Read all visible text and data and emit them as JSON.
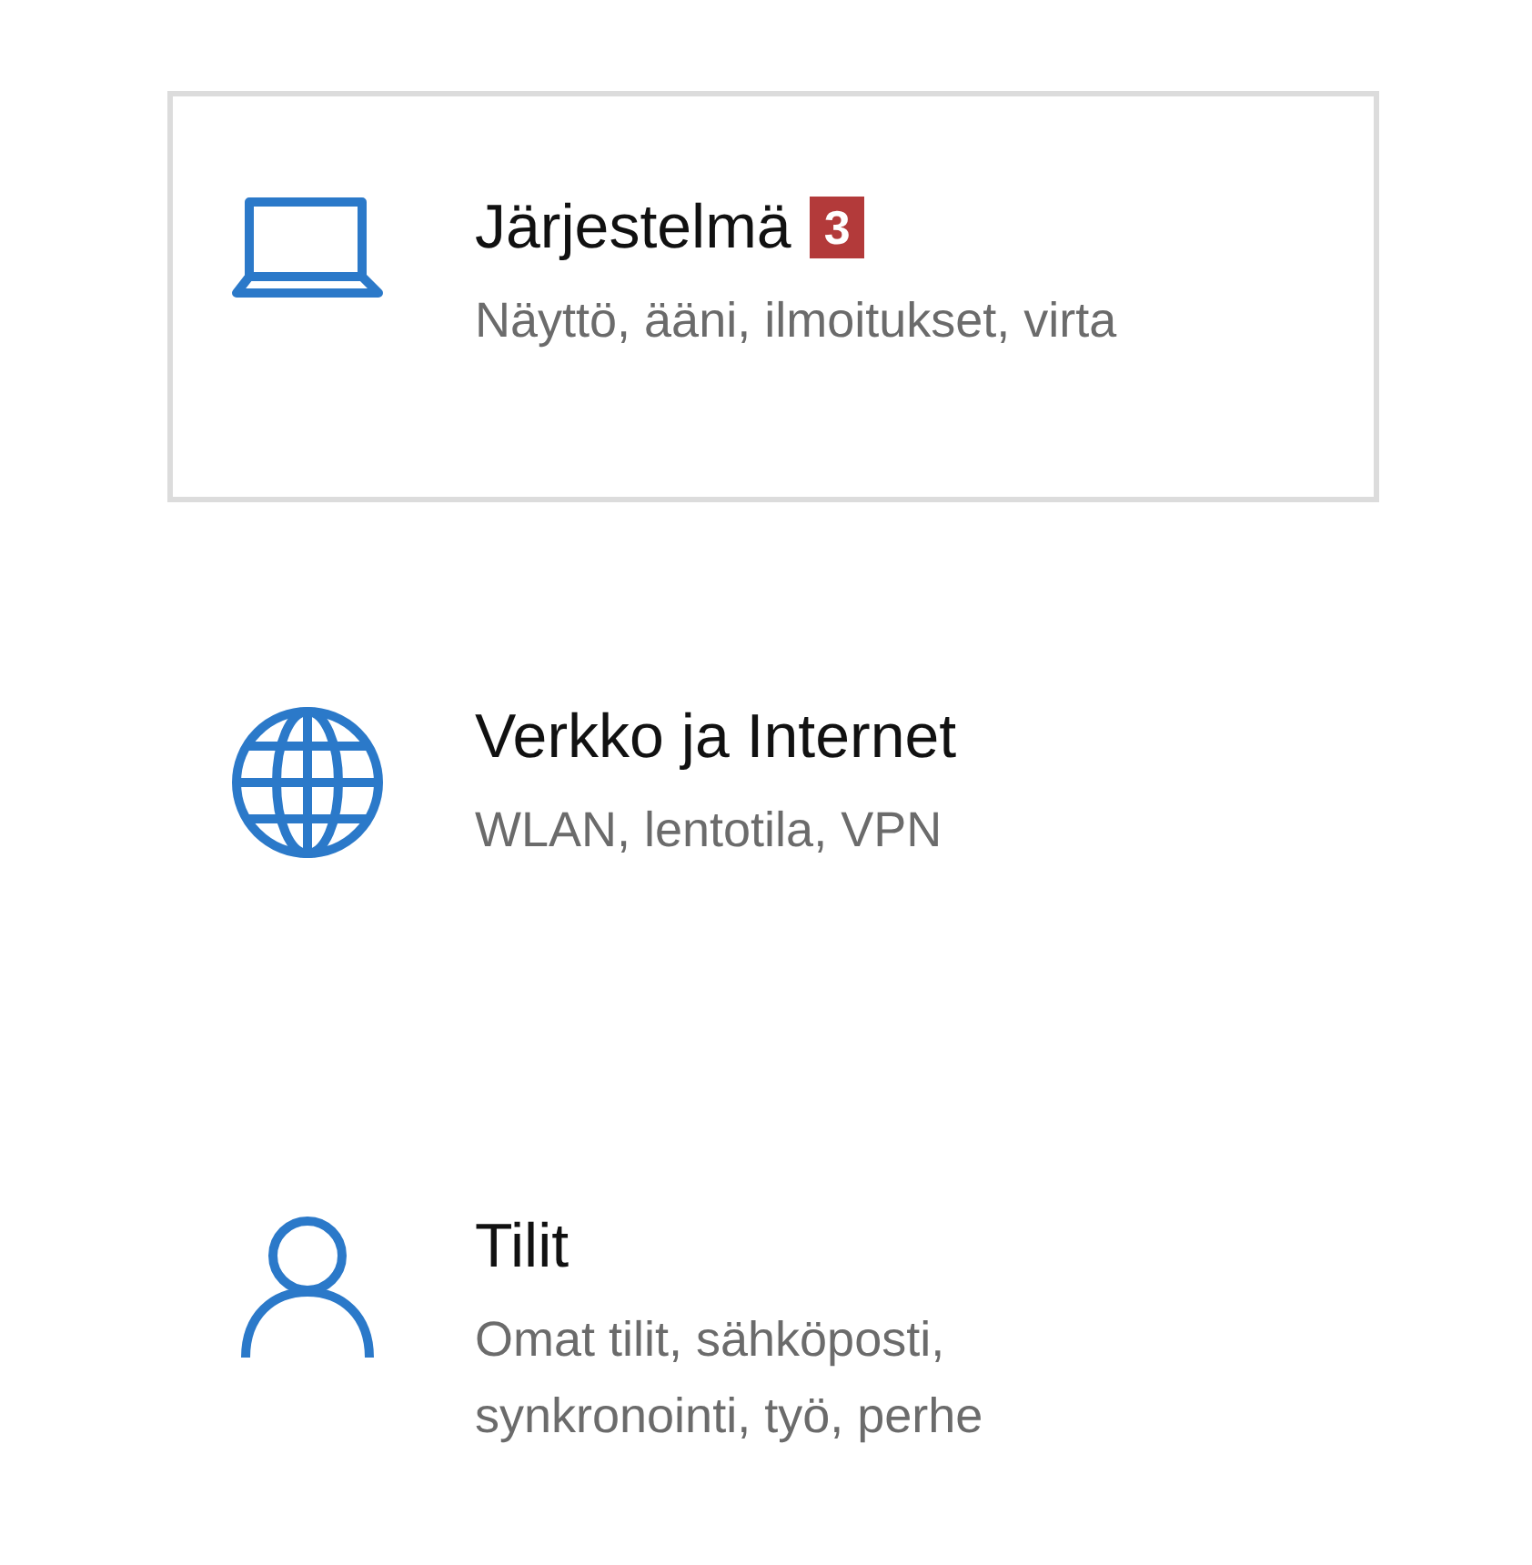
{
  "categories": [
    {
      "kind": "laptop",
      "title": "Järjestelmä",
      "badge": "3",
      "description": "Näyttö, ääni, ilmoitukset, virta",
      "selected": true
    },
    {
      "kind": "globe",
      "title": "Verkko ja Internet",
      "description": "WLAN, lentotila, VPN",
      "selected": false
    },
    {
      "kind": "person",
      "title": "Tilit",
      "description": "Omat tilit, sähköposti,\nsynkronointi, työ, perhe",
      "selected": false
    }
  ]
}
